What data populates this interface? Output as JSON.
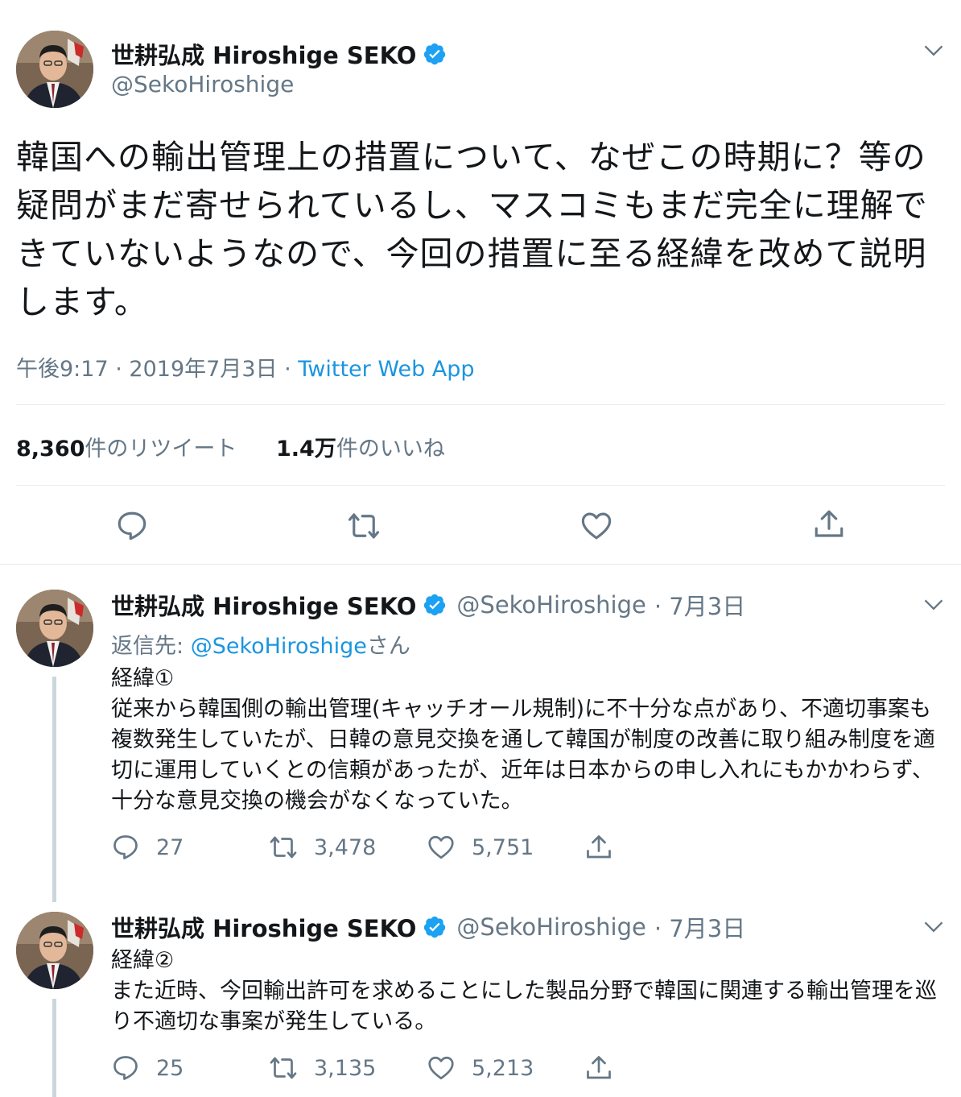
{
  "main_tweet": {
    "author_name": "世耕弘成 Hiroshige SEKO",
    "handle": "@SekoHiroshige",
    "text": "韓国への輸出管理上の措置について、なぜこの時期に？等の疑問がまだ寄せられているし、マスコミもまだ完全に理解できていないようなので、今回の措置に至る経緯を改めて説明します。",
    "time": "午後9:17",
    "date": "2019年7月3日",
    "separator": "·",
    "source": "Twitter Web App",
    "retweets_count": "8,360",
    "retweets_label": "件のリツイート",
    "likes_count": "1.4万",
    "likes_label": "件のいいね"
  },
  "replies": [
    {
      "author_name": "世耕弘成 Hiroshige SEKO",
      "handle": "@SekoHiroshige",
      "date": "· 7月3日",
      "replying_prefix": "返信先: ",
      "replying_handle": "@SekoHiroshige",
      "replying_suffix": "さん",
      "text_heading": "経緯①",
      "text": "従来から韓国側の輸出管理(キャッチオール規制)に不十分な点があり、不適切事案も複数発生していたが、日韓の意見交換を通して韓国が制度の改善に取り組み制度を適切に運用していくとの信頼があったが、近年は日本からの申し入れにもかかわらず、十分な意見交換の機会がなくなっていた。",
      "replies": "27",
      "retweets": "3,478",
      "likes": "5,751"
    },
    {
      "author_name": "世耕弘成 Hiroshige SEKO",
      "handle": "@SekoHiroshige",
      "date": "· 7月3日",
      "text_heading": "経緯②",
      "text": "また近時、今回輸出許可を求めることにした製品分野で韓国に関連する輸出管理を巡り不適切な事案が発生している。",
      "replies": "25",
      "retweets": "3,135",
      "likes": "5,213"
    }
  ],
  "icons": {
    "verified": "verified-badge-icon",
    "menu": "chevron-down-icon",
    "reply": "reply-icon",
    "retweet": "retweet-icon",
    "like": "heart-icon",
    "share": "share-icon"
  },
  "colors": {
    "link": "#1b95e0",
    "muted": "#657786",
    "verified": "#1da1f2",
    "divider": "#e6ecf0"
  }
}
